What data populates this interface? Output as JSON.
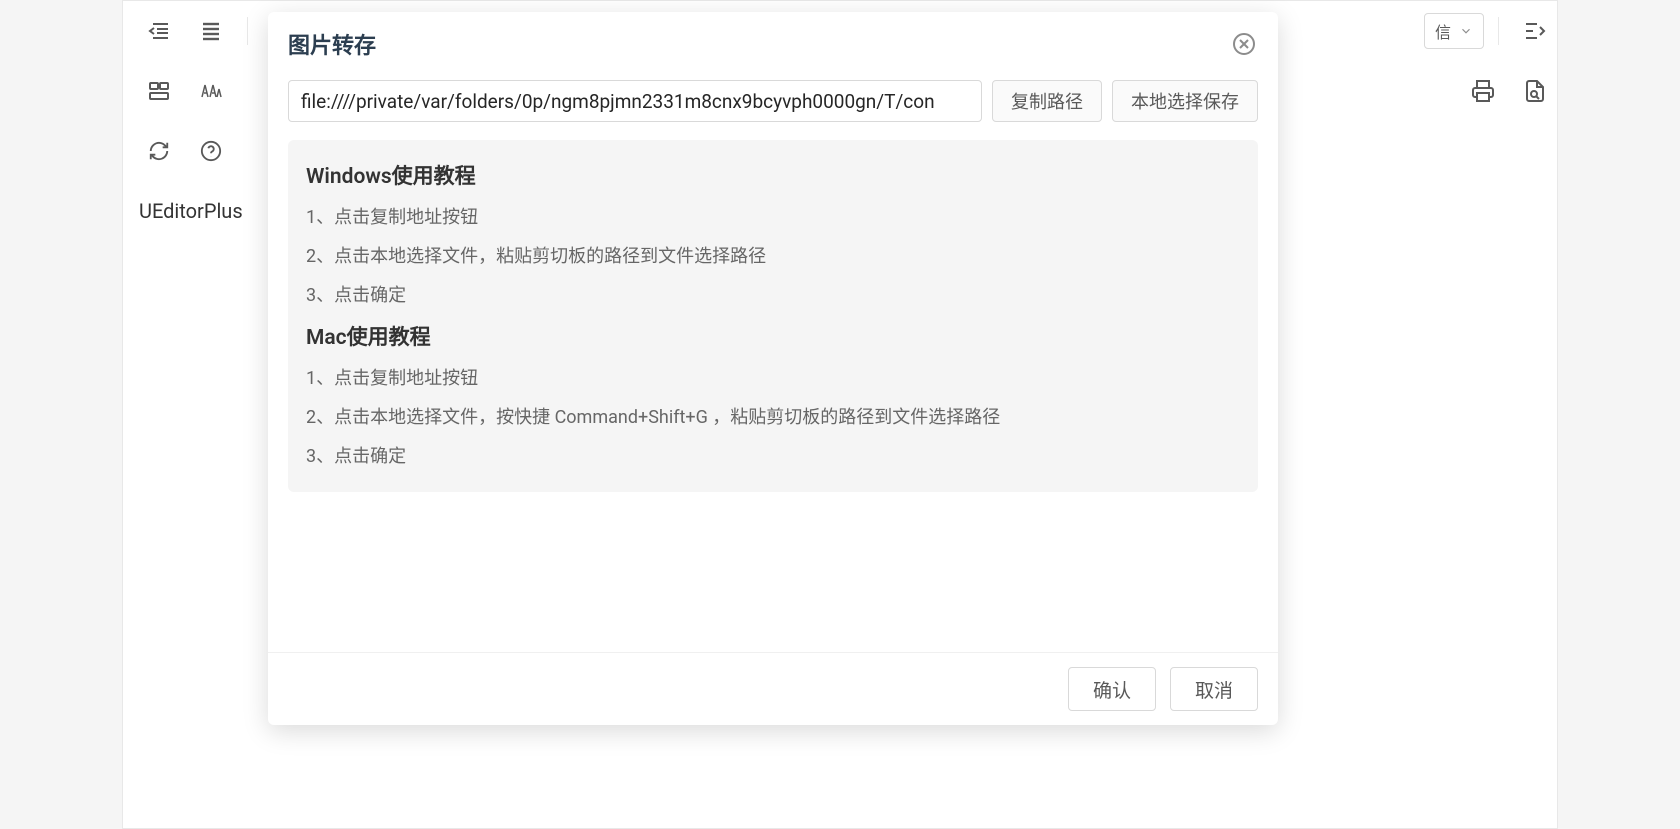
{
  "editor": {
    "content_text": "UEditorPlus",
    "toolbar": {
      "combo_label": "信",
      "icons": {
        "outdent": "outdent-icon",
        "justify": "justify-icon",
        "split_cells": "split-cells-icon",
        "noise": "noise-icon",
        "refresh": "refresh-icon",
        "help": "help-icon",
        "print": "print-icon",
        "preview": "preview-icon",
        "indent_right": "indent-right-icon"
      }
    }
  },
  "modal": {
    "title": "图片转存",
    "path_value": "file:////private/var/folders/0p/ngm8pjmn2331m8cnx9bcyvph0000gn/T/con",
    "copy_path_label": "复制路径",
    "local_save_label": "本地选择保存",
    "instructions": {
      "windows_heading": "Windows使用教程",
      "windows_steps": [
        "1、点击复制地址按钮",
        "2、点击本地选择文件，粘贴剪切板的路径到文件选择路径",
        "3、点击确定"
      ],
      "mac_heading": "Mac使用教程",
      "mac_steps": [
        "1、点击复制地址按钮",
        "2、点击本地选择文件，按快捷 Command+Shift+G ，粘贴剪切板的路径到文件选择路径",
        "3、点击确定"
      ]
    },
    "footer": {
      "confirm": "确认",
      "cancel": "取消"
    }
  }
}
